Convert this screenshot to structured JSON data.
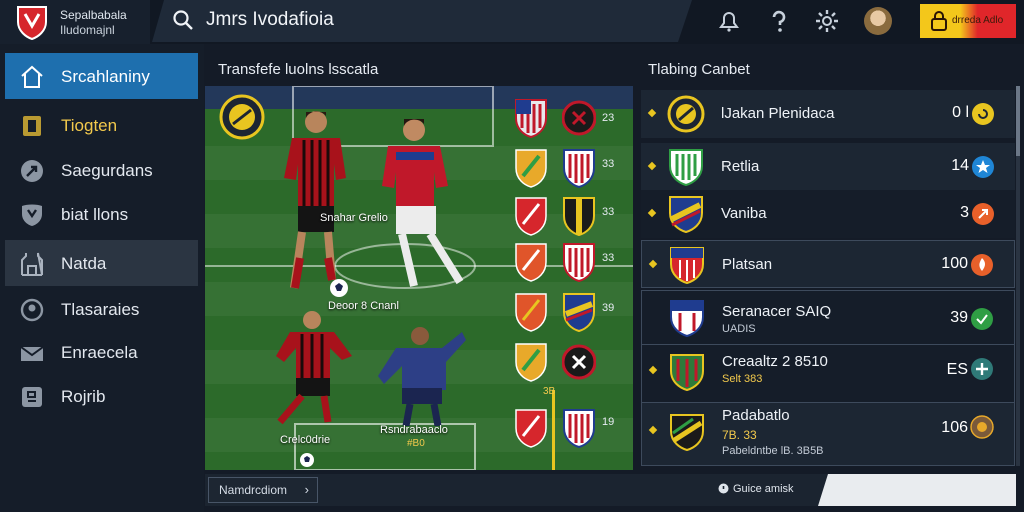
{
  "brand": {
    "line1": "Sepalbabala",
    "line2": "Iludomajnl",
    "logo_icon": "club-shield-icon"
  },
  "search": {
    "text": "Jmrs Ivodafioia",
    "icon": "search-icon"
  },
  "topbar_icons": [
    "bell-icon",
    "help-icon",
    "gear-icon",
    "avatar"
  ],
  "promo": {
    "label": "drreda Adlo",
    "icon": "lock-icon",
    "colors": [
      "#f3c71b",
      "#e0262a"
    ]
  },
  "sidebar": {
    "items": [
      {
        "label": "Srcahlaniny",
        "icon": "home-icon"
      },
      {
        "label": "Tiogten",
        "icon": "clipboard-icon"
      },
      {
        "label": "Saegurdans",
        "icon": "whistle-icon"
      },
      {
        "label": "biat llons",
        "icon": "shield-icon"
      },
      {
        "label": "Natda",
        "icon": "stadium-icon"
      },
      {
        "label": "Tlasaraies",
        "icon": "target-icon"
      },
      {
        "label": "Enraecela",
        "icon": "mail-icon"
      },
      {
        "label": "Rojrib",
        "icon": "report-icon"
      }
    ]
  },
  "transfer": {
    "title": "Transfefe luolns lsscatla",
    "players": [
      {
        "label": "Snahar Grelio"
      },
      {
        "label": "Deoor 8 Cnanl"
      },
      {
        "label": "Crelc0drie"
      },
      {
        "label": "Rsndrabaaclo",
        "sub": "#B0"
      }
    ],
    "crest_numbers": [
      "23",
      "33",
      "33",
      "33",
      "39",
      "19"
    ],
    "marker": "3B"
  },
  "ranking": {
    "title": "Tlabing Canbet",
    "rows": [
      {
        "name": "lJakan Plenidaca",
        "score": "0 l",
        "badge_icon": "coin-badge-icon",
        "badge_color": "#e8c520"
      },
      {
        "name": "Retlia",
        "score": "14",
        "badge_icon": "star-badge-icon",
        "badge_color": "#1f86d6"
      },
      {
        "name": "Vaniba",
        "score": "3",
        "badge_icon": "arrow-badge-icon",
        "badge_color": "#e8602a"
      },
      {
        "name": "Platsan",
        "score": "100",
        "badge_icon": "flame-badge-icon",
        "badge_color": "#e8602a"
      },
      {
        "name": "Seranacer SAIQ",
        "sub": "UADIS",
        "score": "39",
        "badge_icon": "check-badge-icon",
        "badge_color": "#2f9e44"
      },
      {
        "name": "Creaaltz 2 8510",
        "sub": "Selt 383",
        "score": "ES",
        "badge_icon": "plus-badge-icon",
        "badge_color": "#2f7a78"
      },
      {
        "name": "Padabatlo",
        "sub": "7B. 33",
        "sub2": "Pabeldntbe lB. 3B5B",
        "score": "106",
        "badge_icon": "coin-badge-icon",
        "badge_color": "#7a5a3a"
      }
    ]
  },
  "bottom": {
    "button_label": "Namdrcdiom",
    "button_arrow": "›",
    "status_label": "Guice amisk"
  }
}
